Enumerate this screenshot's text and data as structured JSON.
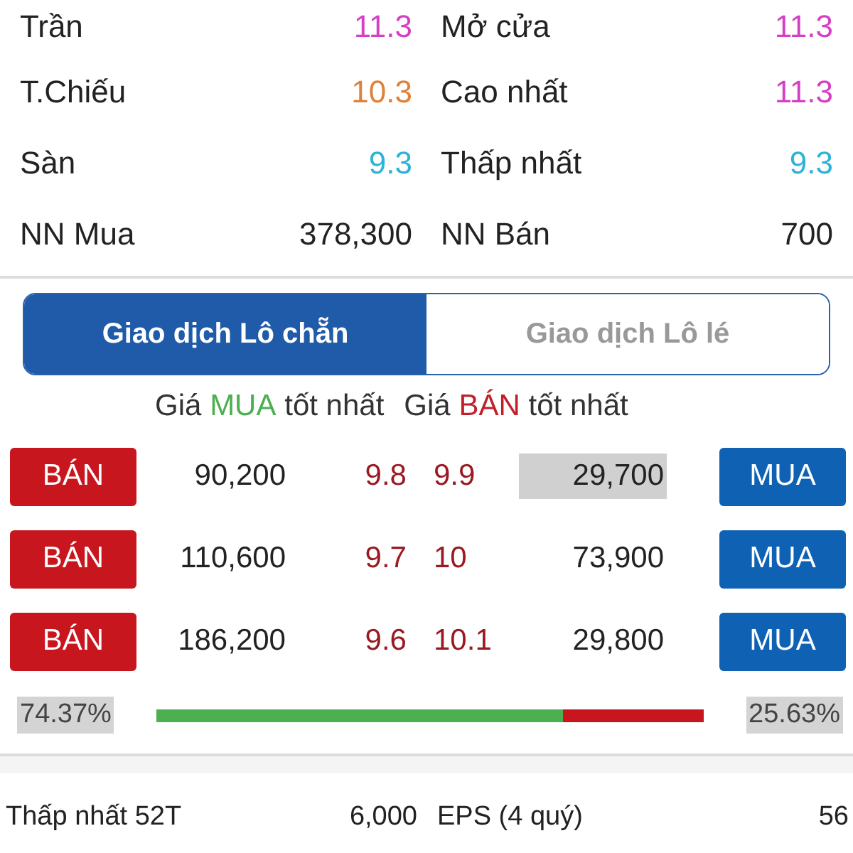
{
  "summary": [
    {
      "left": {
        "label": "Trần",
        "value": "11.3",
        "color": "#d63fc4"
      },
      "right": {
        "label": "Mở cửa",
        "value": "11.3",
        "color": "#d63fc4"
      }
    },
    {
      "left": {
        "label": "T.Chiếu",
        "value": "10.3",
        "color": "#e0813a"
      },
      "right": {
        "label": "Cao nhất",
        "value": "11.3",
        "color": "#d63fc4"
      }
    },
    {
      "left": {
        "label": "Sàn",
        "value": "9.3",
        "color": "#2bb3d8"
      },
      "right": {
        "label": "Thấp nhất",
        "value": "9.3",
        "color": "#2bb3d8"
      }
    },
    {
      "left": {
        "label": "NN Mua",
        "value": "378,300",
        "color": "#222222"
      },
      "right": {
        "label": "NN Bán",
        "value": "700",
        "color": "#222222"
      }
    }
  ],
  "tabs": [
    {
      "label": "Giao dịch Lô chẵn",
      "selected": true
    },
    {
      "label": "Giao dịch Lô lé",
      "selected": false
    }
  ],
  "headers": [
    {
      "parts": [
        {
          "text": "Giá",
          "color": "#333333"
        },
        {
          "text": "MUA",
          "color": "#4caf50"
        },
        {
          "text": "tốt nhất",
          "color": "#333333"
        }
      ]
    },
    {
      "parts": [
        {
          "text": "Giá",
          "color": "#333333"
        },
        {
          "text": "BÁN",
          "color": "#c0202a"
        },
        {
          "text": "tốt nhất",
          "color": "#333333"
        }
      ]
    }
  ],
  "orders": [
    {
      "sell_button": "BÁN",
      "bid_volume": "90,200",
      "bid_price": "9.8",
      "ask_price": "9.9",
      "ask_volume": "29,700",
      "ask_highlighted": true,
      "buy_button": "MUA"
    },
    {
      "sell_button": "BÁN",
      "bid_volume": "110,600",
      "bid_price": "9.7",
      "ask_price": "10",
      "ask_volume": "73,900",
      "ask_highlighted": false,
      "buy_button": "MUA"
    },
    {
      "sell_button": "BÁN",
      "bid_volume": "186,200",
      "bid_price": "9.6",
      "ask_price": "10.1",
      "ask_volume": "29,800",
      "ask_highlighted": false,
      "buy_button": "MUA"
    }
  ],
  "balance": {
    "buy_percent": "74.37%",
    "sell_percent": "25.63%",
    "level": 0.7437
  },
  "stats": [
    {
      "left": {
        "label": "Thấp nhất 52T",
        "value": "6,000"
      },
      "right": {
        "label": "EPS (4 quý)",
        "value": "56"
      }
    }
  ]
}
